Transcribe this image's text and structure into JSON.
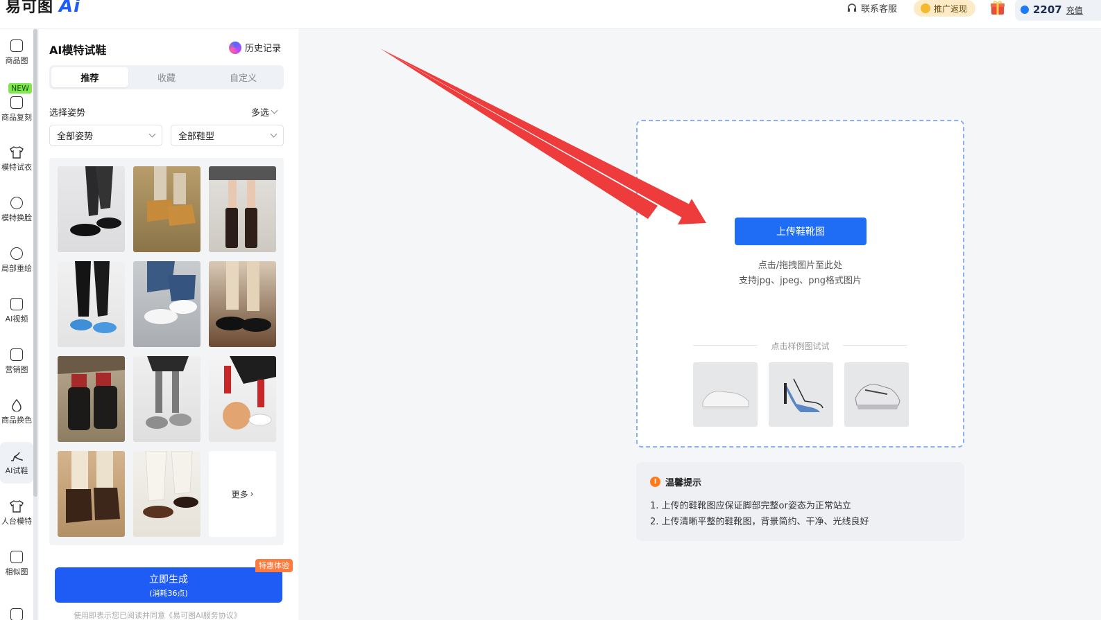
{
  "header": {
    "logo_text": "易可图",
    "logo_ai": "Ai",
    "service_label": "联系客服",
    "promo_label": "推广返现",
    "points_value": "2207",
    "recharge_label": "充值"
  },
  "rail": {
    "new_badge": "NEW",
    "items": [
      {
        "label": "商品图"
      },
      {
        "label": "商品复刻"
      },
      {
        "label": "模特试衣"
      },
      {
        "label": "模特换脸"
      },
      {
        "label": "局部重绘"
      },
      {
        "label": "AI视频"
      },
      {
        "label": "营销图"
      },
      {
        "label": "商品换色"
      },
      {
        "label": "AI试鞋"
      },
      {
        "label": "人台模特"
      },
      {
        "label": "相似图"
      }
    ]
  },
  "panel": {
    "title": "AI模特试鞋",
    "history_label": "历史记录",
    "tabs": [
      {
        "label": "推荐"
      },
      {
        "label": "收藏"
      },
      {
        "label": "自定义"
      }
    ],
    "pose_label": "选择姿势",
    "multi_label": "多选",
    "select_pose": "全部姿势",
    "select_shoe": "全部鞋型",
    "more_label": "更多",
    "generate_label": "立即生成",
    "generate_cost": "(消耗36点)",
    "special_badge": "特惠体验",
    "footer_note": "使用即表示您已阅读并同意《易可图AI服务协议》"
  },
  "upload": {
    "button_label": "上传鞋靴图",
    "hint_line1": "点击/拖拽图片至此处",
    "hint_line2": "支持jpg、jpeg、png格式图片",
    "sample_label": "点击样例图试试"
  },
  "tips": {
    "title": "温馨提示",
    "items": [
      "1. 上传的鞋靴图应保证脚部完整or姿态为正常站立",
      "2. 上传清晰平整的鞋靴图，背景简约、干净、光线良好"
    ]
  }
}
